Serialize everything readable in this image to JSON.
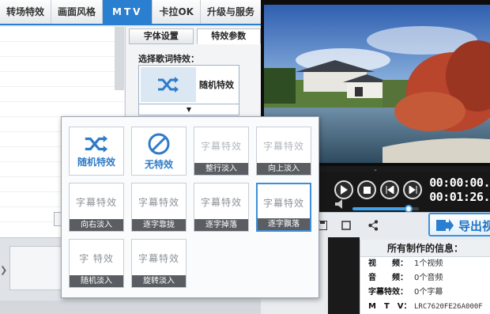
{
  "tabs": [
    {
      "label": "转场特效"
    },
    {
      "label": "画面风格"
    },
    {
      "label": "MTV"
    },
    {
      "label": "卡拉OK"
    },
    {
      "label": "升级与服务"
    }
  ],
  "panel": {
    "subtabs": [
      "字体设置",
      "特效参数"
    ],
    "label": "选择歌词特效：",
    "selected_effect": "随机特效",
    "dropdown_glyph": "▼"
  },
  "effects": [
    {
      "label": "随机特效",
      "icon": "shuffle-icon"
    },
    {
      "label": "无特效",
      "icon": "no-effect-icon"
    },
    {
      "label": "整行淡入",
      "preview": "字幕特效"
    },
    {
      "label": "向上淡入",
      "preview": "字幕特效"
    },
    {
      "label": "向右淡入",
      "preview": "字幕特效"
    },
    {
      "label": "逐字靠拢",
      "preview": "字幕特效"
    },
    {
      "label": "逐字掉落",
      "preview": "字幕特效"
    },
    {
      "label": "逐字飘落",
      "preview": "字幕特效"
    },
    {
      "label": "随机淡入",
      "preview": "字 特效"
    },
    {
      "label": "旋转淡入",
      "preview": "字幕特效"
    }
  ],
  "player": {
    "current_time": "00:00:00.",
    "total_time": "00:01:26.",
    "volume_level": 0.85,
    "export_label": "导出视"
  },
  "info": {
    "title": "所有制作的信息：",
    "rows": [
      {
        "key": "视　　频：",
        "value": "1个视频"
      },
      {
        "key": "音　　频：",
        "value": "0个音频"
      },
      {
        "key": "字幕特效：",
        "value": "0个字幕"
      },
      {
        "key": "M　T　V：",
        "value": "LRC7620FE26A000F"
      }
    ]
  },
  "colors": {
    "accent": "#2a7fd0",
    "caption_bg": "#5a5d62",
    "info_blue": "#3a93e4"
  }
}
